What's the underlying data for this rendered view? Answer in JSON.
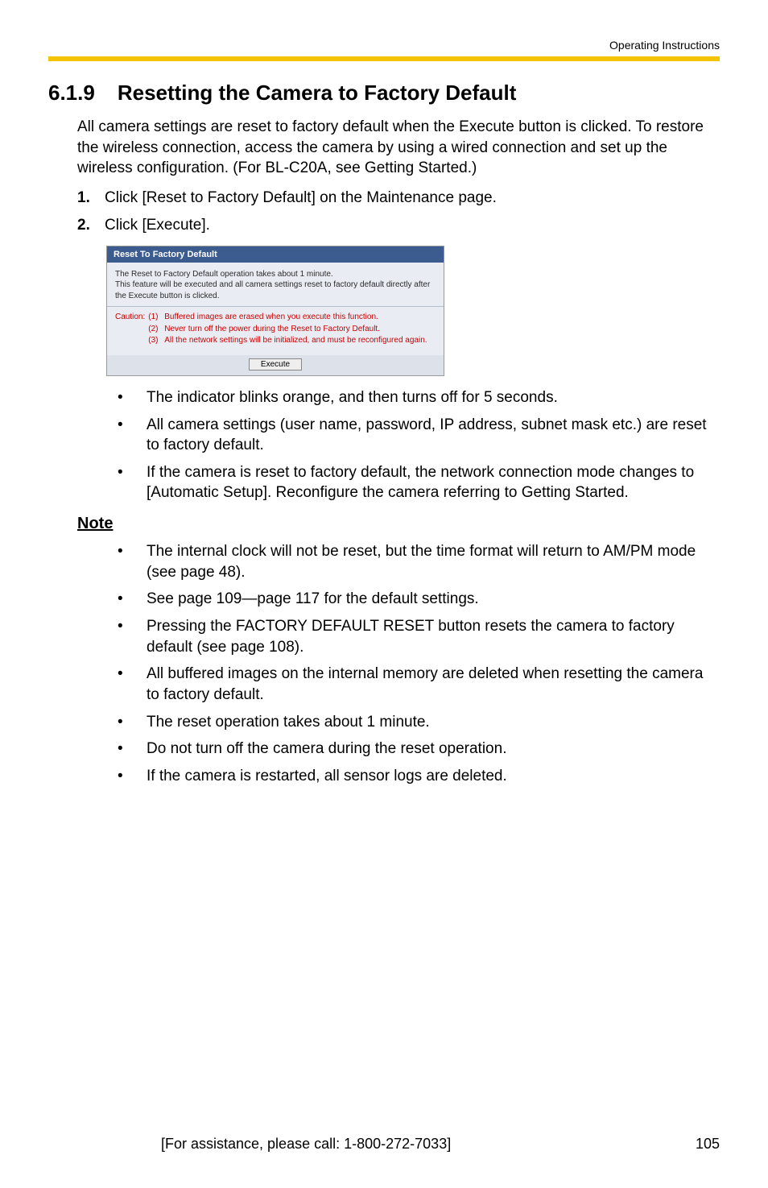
{
  "header": {
    "doc_label": "Operating Instructions"
  },
  "heading": {
    "number": "6.1.9",
    "title": "Resetting the Camera to Factory Default"
  },
  "intro": "All camera settings are reset to factory default when the Execute button is clicked. To restore the wireless connection, access the camera by using a wired connection and set up the wireless configuration. (For BL-C20A, see Getting Started.)",
  "steps": [
    {
      "n": "1.",
      "text": "Click [Reset to Factory Default] on the Maintenance page."
    },
    {
      "n": "2.",
      "text": "Click [Execute]."
    }
  ],
  "figure": {
    "titlebar": "Reset To Factory Default",
    "para": "The Reset to Factory Default operation takes about 1 minute.\nThis feature will be executed and all camera settings reset to factory default directly after the Execute button is clicked.",
    "caution_label": "Caution:",
    "caution_items": [
      {
        "n": "(1)",
        "text": "Buffered images are erased when you execute this function."
      },
      {
        "n": "(2)",
        "text": "Never turn off the power during the Reset to Factory Default."
      },
      {
        "n": "(3)",
        "text": "All the network settings will be initialized, and must be reconfigured again."
      }
    ],
    "button": "Execute"
  },
  "post_bullets": [
    "The indicator blinks orange, and then turns off for 5 seconds.",
    "All camera settings (user name, password, IP address, subnet mask etc.) are reset to factory default.",
    "If the camera is reset to factory default, the network connection mode changes to [Automatic Setup]. Reconfigure the camera referring to Getting Started."
  ],
  "note_label": "Note",
  "note_bullets": [
    "The internal clock will not be reset, but the time format will return to AM/PM mode (see page 48).",
    "See page 109—page 117 for the default settings.",
    "Pressing the FACTORY DEFAULT RESET button resets the camera to factory default (see page 108).",
    "All buffered images on the internal memory are deleted when resetting the camera to factory default.",
    "The reset operation takes about 1 minute.",
    "Do not turn off the camera during the reset operation.",
    "If the camera is restarted, all sensor logs are deleted."
  ],
  "footer": {
    "assist": "[For assistance, please call: 1-800-272-7033]",
    "page": "105"
  }
}
